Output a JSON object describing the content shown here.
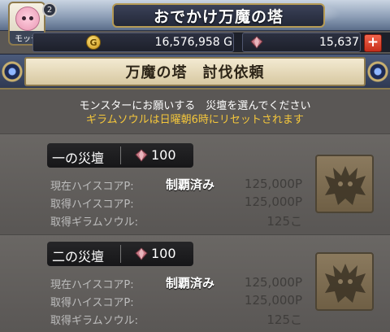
{
  "header": {
    "title": "おでかけ万魔の塔",
    "avatar_name": "モッチ",
    "avatar_badge": "2"
  },
  "currency": {
    "gold_icon_letter": "G",
    "gold": "16,576,958 G",
    "gems": "15,637",
    "plus_label": "+"
  },
  "section": {
    "title": "万魔の塔　討伐依頼"
  },
  "notice": {
    "line1": "モンスターにお願いする　災壇を選んでください",
    "line2": "ギラムソウルは日曜朝6時にリセットされます"
  },
  "altars": [
    {
      "name": "一の災壇",
      "cost": "100",
      "status": "制覇済み",
      "rows": [
        {
          "label": "現在ハイスコアP:",
          "value": "125,000P"
        },
        {
          "label": "取得ハイスコアP:",
          "value": "125,000P"
        },
        {
          "label": "取得ギラムソウル:",
          "value": "125こ"
        }
      ]
    },
    {
      "name": "二の災壇",
      "cost": "100",
      "status": "制覇済み",
      "rows": [
        {
          "label": "現在ハイスコアP:",
          "value": "125,000P"
        },
        {
          "label": "取得ハイスコアP:",
          "value": "125,000P"
        },
        {
          "label": "取得ギラムソウル:",
          "value": "125こ"
        }
      ]
    }
  ],
  "colors": {
    "notice_highlight": "#f5c73b",
    "stat_value": "#3f3d3b",
    "plus_button": "#d9402a"
  },
  "icons": {
    "gold": "gold-coin-icon",
    "gem": "gem-icon",
    "monster": "monster-silhouette-icon"
  }
}
